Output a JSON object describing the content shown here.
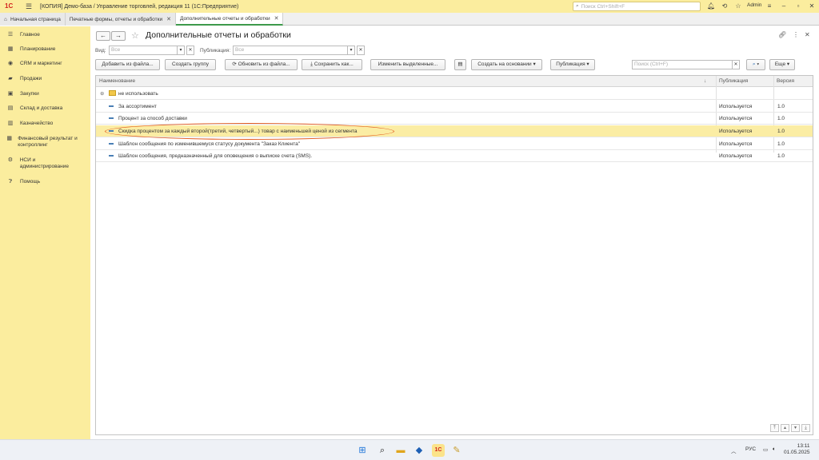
{
  "titlebar": {
    "title": "[КОПИЯ] Демо-база / Управление торговлей, редакция 11  (1С:Предприятие)",
    "search_placeholder": "Поиск Ctrl+Shift+F",
    "user": "Admin",
    "logo_text": "1С"
  },
  "tabs": [
    {
      "label": "Начальная страница"
    },
    {
      "label": "Печатные формы, отчеты и обработки"
    },
    {
      "label": "Дополнительные отчеты и обработки"
    }
  ],
  "sidebar": {
    "items": [
      {
        "label": "Главное",
        "icon": "menu-icon"
      },
      {
        "label": "Планирование",
        "icon": "calendar-icon"
      },
      {
        "label": "CRM и маркетинг",
        "icon": "crm-icon"
      },
      {
        "label": "Продажи",
        "icon": "sales-icon"
      },
      {
        "label": "Закупки",
        "icon": "purchases-icon"
      },
      {
        "label": "Склад и доставка",
        "icon": "warehouse-icon"
      },
      {
        "label": "Казначейство",
        "icon": "treasury-icon"
      },
      {
        "label": "Финансовый результат и контроллинг",
        "icon": "finance-icon"
      },
      {
        "label": "НСИ и администрирование",
        "icon": "settings-icon"
      },
      {
        "label": "Помощь",
        "icon": "help-icon"
      }
    ]
  },
  "page": {
    "title": "Дополнительные отчеты и обработки"
  },
  "filters": {
    "view_label": "Вид:",
    "view_value": "Все",
    "publication_label": "Публикация:",
    "publication_value": "Все"
  },
  "toolbar": {
    "add_from_file": "Добавить из файла...",
    "create_group": "Создать группу",
    "update_from_file": "Обновить из файла...",
    "save_as": "Сохранить как...",
    "edit_selected": "Изменить выделенные...",
    "create_based_on": "Создать на основании",
    "publication": "Публикация",
    "search_placeholder": "Поиск (Ctrl+F)",
    "more": "Еще"
  },
  "table": {
    "columns": [
      "Наименование",
      "Публикация",
      "Версия"
    ],
    "rows": [
      {
        "name": "не использовать",
        "publication": "",
        "version": "",
        "type": "folder"
      },
      {
        "name": "За ассортимент",
        "publication": "Используется",
        "version": "1.0",
        "type": "item"
      },
      {
        "name": "Процент за способ доставки",
        "publication": "Используется",
        "version": "1.0",
        "type": "item"
      },
      {
        "name": "Скидка процентом за каждый второй(третий, четвертый...) товар с наименьшей ценой из сегмента",
        "publication": "Используется",
        "version": "1.0",
        "type": "item",
        "selected": true
      },
      {
        "name": "Шаблон сообщения по изменившемуся статусу документа \"Заказ Клиента\"",
        "publication": "Используется",
        "version": "1.0",
        "type": "item"
      },
      {
        "name": "Шаблон сообщения, предназначенный для оповещения о выписке счета (SMS).",
        "publication": "Используется",
        "version": "1.0",
        "type": "item"
      }
    ]
  },
  "taskbar": {
    "lang": "РУС",
    "time": "13:11",
    "date": "01.05.2025"
  },
  "colors": {
    "accent_yellow": "#fbed9e",
    "selected_row": "#fbeda4",
    "annotation_ellipse": "#e35d22",
    "active_tab_underline": "#3d9a4b"
  }
}
